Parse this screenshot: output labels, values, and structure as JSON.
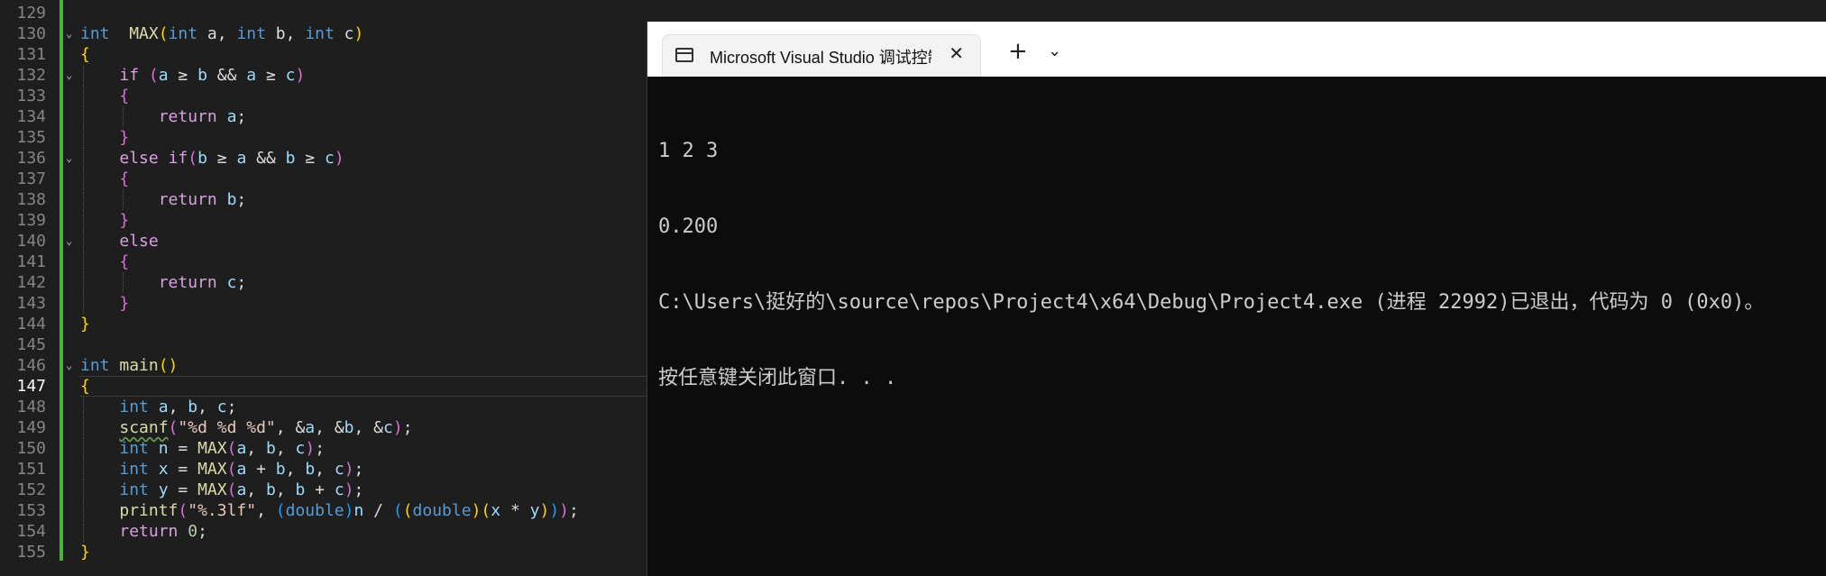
{
  "editor": {
    "lines": [
      {
        "ln": "129",
        "indent": 0,
        "tokens": []
      },
      {
        "ln": "130",
        "fold": true,
        "indent": 0,
        "tokens": [
          [
            "kw",
            "int"
          ],
          [
            "",
            "  "
          ],
          [
            "fn",
            "MAX"
          ],
          [
            "b1",
            "("
          ],
          [
            "kw",
            "int"
          ],
          [
            "",
            " a, "
          ],
          [
            "kw",
            "int"
          ],
          [
            "",
            " b, "
          ],
          [
            "kw",
            "int"
          ],
          [
            "",
            " c"
          ],
          [
            "b1",
            ")"
          ]
        ]
      },
      {
        "ln": "131",
        "indent": 0,
        "tokens": [
          [
            "b1",
            "{"
          ]
        ]
      },
      {
        "ln": "132",
        "fold": true,
        "indent": 1,
        "tokens": [
          [
            "",
            "    "
          ],
          [
            "ctl",
            "if"
          ],
          [
            "",
            " "
          ],
          [
            "b2",
            "("
          ],
          [
            "var",
            "a"
          ],
          [
            "",
            " ≥ "
          ],
          [
            "var",
            "b"
          ],
          [
            "",
            " && "
          ],
          [
            "var",
            "a"
          ],
          [
            "",
            " ≥ "
          ],
          [
            "var",
            "c"
          ],
          [
            "b2",
            ")"
          ]
        ]
      },
      {
        "ln": "133",
        "indent": 1,
        "tokens": [
          [
            "",
            "    "
          ],
          [
            "b2",
            "{"
          ]
        ]
      },
      {
        "ln": "134",
        "indent": 2,
        "tokens": [
          [
            "",
            "        "
          ],
          [
            "ctl",
            "return"
          ],
          [
            "",
            " "
          ],
          [
            "var",
            "a"
          ],
          [
            "",
            ";"
          ]
        ]
      },
      {
        "ln": "135",
        "indent": 1,
        "tokens": [
          [
            "",
            "    "
          ],
          [
            "b2",
            "}"
          ]
        ]
      },
      {
        "ln": "136",
        "fold": true,
        "indent": 1,
        "tokens": [
          [
            "",
            "    "
          ],
          [
            "ctl",
            "else"
          ],
          [
            "",
            " "
          ],
          [
            "ctl",
            "if"
          ],
          [
            "b2",
            "("
          ],
          [
            "var",
            "b"
          ],
          [
            "",
            " ≥ "
          ],
          [
            "var",
            "a"
          ],
          [
            "",
            " && "
          ],
          [
            "var",
            "b"
          ],
          [
            "",
            " ≥ "
          ],
          [
            "var",
            "c"
          ],
          [
            "b2",
            ")"
          ]
        ]
      },
      {
        "ln": "137",
        "indent": 1,
        "tokens": [
          [
            "",
            "    "
          ],
          [
            "b2",
            "{"
          ]
        ]
      },
      {
        "ln": "138",
        "indent": 2,
        "tokens": [
          [
            "",
            "        "
          ],
          [
            "ctl",
            "return"
          ],
          [
            "",
            " "
          ],
          [
            "var",
            "b"
          ],
          [
            "",
            ";"
          ]
        ]
      },
      {
        "ln": "139",
        "indent": 1,
        "tokens": [
          [
            "",
            "    "
          ],
          [
            "b2",
            "}"
          ]
        ]
      },
      {
        "ln": "140",
        "fold": true,
        "indent": 1,
        "tokens": [
          [
            "",
            "    "
          ],
          [
            "ctl",
            "else"
          ]
        ]
      },
      {
        "ln": "141",
        "indent": 1,
        "tokens": [
          [
            "",
            "    "
          ],
          [
            "b2",
            "{"
          ]
        ]
      },
      {
        "ln": "142",
        "indent": 2,
        "tokens": [
          [
            "",
            "        "
          ],
          [
            "ctl",
            "return"
          ],
          [
            "",
            " "
          ],
          [
            "var",
            "c"
          ],
          [
            "",
            ";"
          ]
        ]
      },
      {
        "ln": "143",
        "indent": 1,
        "tokens": [
          [
            "",
            "    "
          ],
          [
            "b2",
            "}"
          ]
        ]
      },
      {
        "ln": "144",
        "indent": 0,
        "tokens": [
          [
            "b1",
            "}"
          ]
        ]
      },
      {
        "ln": "145",
        "indent": 0,
        "tokens": []
      },
      {
        "ln": "146",
        "fold": true,
        "indent": 0,
        "tokens": [
          [
            "kw",
            "int"
          ],
          [
            "",
            " "
          ],
          [
            "fn",
            "main"
          ],
          [
            "b1",
            "()"
          ]
        ]
      },
      {
        "ln": "147",
        "current": true,
        "indent": 0,
        "tokens": [
          [
            "b1",
            "{"
          ]
        ]
      },
      {
        "ln": "148",
        "indent": 1,
        "tokens": [
          [
            "",
            "    "
          ],
          [
            "kw",
            "int"
          ],
          [
            "",
            " "
          ],
          [
            "var",
            "a"
          ],
          [
            "",
            ", "
          ],
          [
            "var",
            "b"
          ],
          [
            "",
            ", "
          ],
          [
            "var",
            "c"
          ],
          [
            "",
            ";"
          ]
        ]
      },
      {
        "ln": "149",
        "indent": 1,
        "tokens": [
          [
            "",
            "    "
          ],
          [
            "fn squig",
            "scanf"
          ],
          [
            "b2",
            "("
          ],
          [
            "str",
            "\"%d %d %d\""
          ],
          [
            "",
            ", "
          ],
          [
            "",
            "&"
          ],
          [
            "var",
            "a"
          ],
          [
            "",
            ", &"
          ],
          [
            "var",
            "b"
          ],
          [
            "",
            ", &"
          ],
          [
            "var",
            "c"
          ],
          [
            "b2",
            ")"
          ],
          [
            "",
            ";"
          ]
        ]
      },
      {
        "ln": "150",
        "indent": 1,
        "tokens": [
          [
            "",
            "    "
          ],
          [
            "kw",
            "int"
          ],
          [
            "",
            " "
          ],
          [
            "var",
            "n"
          ],
          [
            "",
            " = "
          ],
          [
            "fn",
            "MAX"
          ],
          [
            "b2",
            "("
          ],
          [
            "var",
            "a"
          ],
          [
            "",
            ", "
          ],
          [
            "var",
            "b"
          ],
          [
            "",
            ", "
          ],
          [
            "var",
            "c"
          ],
          [
            "b2",
            ")"
          ],
          [
            "",
            ";"
          ]
        ]
      },
      {
        "ln": "151",
        "indent": 1,
        "tokens": [
          [
            "",
            "    "
          ],
          [
            "kw",
            "int"
          ],
          [
            "",
            " "
          ],
          [
            "var",
            "x"
          ],
          [
            "",
            " = "
          ],
          [
            "fn",
            "MAX"
          ],
          [
            "b2",
            "("
          ],
          [
            "var",
            "a"
          ],
          [
            "",
            " + "
          ],
          [
            "var",
            "b"
          ],
          [
            "",
            ", "
          ],
          [
            "var",
            "b"
          ],
          [
            "",
            ", "
          ],
          [
            "var",
            "c"
          ],
          [
            "b2",
            ")"
          ],
          [
            "",
            ";"
          ]
        ]
      },
      {
        "ln": "152",
        "indent": 1,
        "tokens": [
          [
            "",
            "    "
          ],
          [
            "kw",
            "int"
          ],
          [
            "",
            " "
          ],
          [
            "var",
            "y"
          ],
          [
            "",
            " = "
          ],
          [
            "fn",
            "MAX"
          ],
          [
            "b2",
            "("
          ],
          [
            "var",
            "a"
          ],
          [
            "",
            ", "
          ],
          [
            "var",
            "b"
          ],
          [
            "",
            ", "
          ],
          [
            "var",
            "b"
          ],
          [
            "",
            " + "
          ],
          [
            "var",
            "c"
          ],
          [
            "b2",
            ")"
          ],
          [
            "",
            ";"
          ]
        ]
      },
      {
        "ln": "153",
        "indent": 1,
        "tokens": [
          [
            "",
            "    "
          ],
          [
            "fn",
            "printf"
          ],
          [
            "b2",
            "("
          ],
          [
            "str",
            "\"%.3lf\""
          ],
          [
            "",
            ", "
          ],
          [
            "b3",
            "("
          ],
          [
            "kw",
            "double"
          ],
          [
            "b3",
            ")"
          ],
          [
            "var",
            "n"
          ],
          [
            "",
            " / "
          ],
          [
            "b3",
            "("
          ],
          [
            "b1",
            "("
          ],
          [
            "kw",
            "double"
          ],
          [
            "b1",
            ")"
          ],
          [
            "b1",
            "("
          ],
          [
            "var",
            "x"
          ],
          [
            "",
            " * "
          ],
          [
            "var",
            "y"
          ],
          [
            "b1",
            ")"
          ],
          [
            "b3",
            ")"
          ],
          [
            "b2",
            ")"
          ],
          [
            "",
            ";"
          ]
        ]
      },
      {
        "ln": "154",
        "indent": 1,
        "tokens": [
          [
            "",
            "    "
          ],
          [
            "ctl",
            "return"
          ],
          [
            "",
            " "
          ],
          [
            "num",
            "0"
          ],
          [
            "",
            ";"
          ]
        ]
      },
      {
        "ln": "155",
        "indent": 0,
        "tokens": [
          [
            "b1",
            "}"
          ]
        ]
      }
    ]
  },
  "terminal": {
    "tab_title": "Microsoft Visual Studio 调试控制台",
    "tab_icon": "terminal-icon",
    "close_glyph": "✕",
    "new_tab_glyph": "+",
    "dropdown_glyph": "⌄",
    "output": [
      "1 2 3",
      "0.200",
      "C:\\Users\\挺好的\\source\\repos\\Project4\\x64\\Debug\\Project4.exe (进程 22992)已退出，代码为 0 (0x0)。",
      "按任意键关闭此窗口. . ."
    ]
  },
  "colors": {
    "editor_bg": "#1e1e1e",
    "terminal_bg": "#0c0c0c",
    "keyword": "#569cd6",
    "control": "#d8a0df",
    "function": "#dcdcaa",
    "variable": "#9cdcfe",
    "string": "#e8c9bb",
    "change_bar": "#4cb340"
  }
}
